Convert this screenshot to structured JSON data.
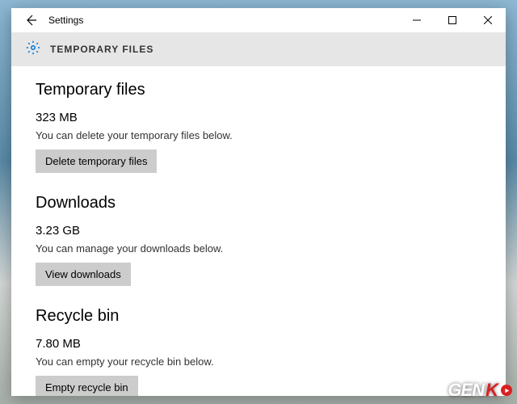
{
  "window": {
    "title": "Settings"
  },
  "header": {
    "title": "TEMPORARY FILES"
  },
  "sections": {
    "temp": {
      "title": "Temporary files",
      "size": "323 MB",
      "desc": "You can delete your temporary files below.",
      "button": "Delete temporary files"
    },
    "downloads": {
      "title": "Downloads",
      "size": "3.23 GB",
      "desc": "You can manage your downloads below.",
      "button": "View downloads"
    },
    "recycle": {
      "title": "Recycle bin",
      "size": "7.80 MB",
      "desc": "You can empty your recycle bin below.",
      "button": "Empty recycle bin"
    }
  },
  "watermark": {
    "prefix": "GEN",
    "suffix": "K"
  }
}
